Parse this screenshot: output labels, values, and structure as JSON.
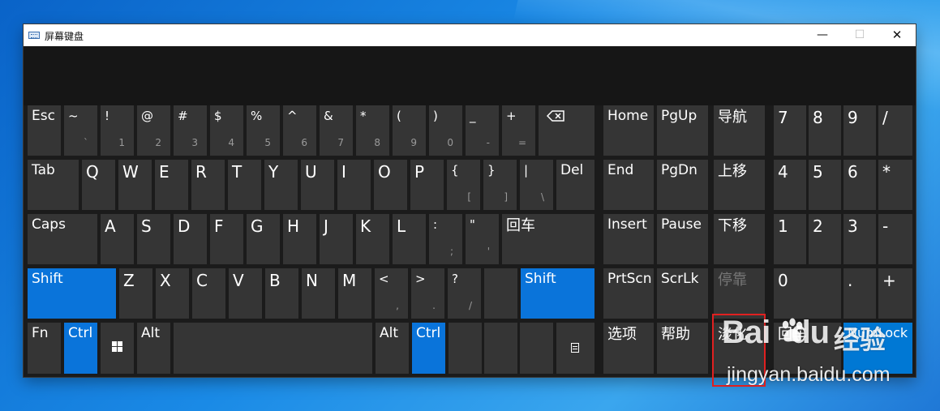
{
  "window": {
    "title": "屏幕键盘",
    "minimize": "—",
    "maximize": "☐",
    "close": "✕"
  },
  "keys": {
    "esc": "Esc",
    "tilde_top": "~",
    "tilde_bottom": "`",
    "k1_top": "!",
    "k1_bottom": "1",
    "k2_top": "@",
    "k2_bottom": "2",
    "k3_top": "#",
    "k3_bottom": "3",
    "k4_top": "$",
    "k4_bottom": "4",
    "k5_top": "%",
    "k5_bottom": "5",
    "k6_top": "^",
    "k6_bottom": "6",
    "k7_top": "&",
    "k7_bottom": "7",
    "k8_top": "*",
    "k8_bottom": "8",
    "k9_top": "(",
    "k9_bottom": "9",
    "k0_top": ")",
    "k0_bottom": "0",
    "minus_top": "_",
    "minus_bottom": "-",
    "equals_top": "+",
    "equals_bottom": "=",
    "tab": "Tab",
    "q": "Q",
    "w": "W",
    "e": "E",
    "r": "R",
    "t": "T",
    "y": "Y",
    "u": "U",
    "i": "I",
    "o": "O",
    "p": "P",
    "lbracket_top": "{",
    "lbracket_bottom": "[",
    "rbracket_top": "}",
    "rbracket_bottom": "]",
    "backslash_top": "|",
    "backslash_bottom": "\\",
    "del": "Del",
    "caps": "Caps",
    "a": "A",
    "s": "S",
    "d": "D",
    "f": "F",
    "g": "G",
    "h": "H",
    "j": "J",
    "k": "K",
    "l": "L",
    "semicolon_top": ":",
    "semicolon_bottom": ";",
    "quote_top": "\"",
    "quote_bottom": "'",
    "enter": "回车",
    "lshift": "Shift",
    "z": "Z",
    "x": "X",
    "c": "C",
    "v": "V",
    "b": "B",
    "n": "N",
    "m": "M",
    "comma_top": "<",
    "comma_bottom": ",",
    "period_top": ">",
    "period_bottom": ".",
    "slash_top": "?",
    "slash_bottom": "/",
    "rshift": "Shift",
    "fn": "Fn",
    "lctrl": "Ctrl",
    "lalt": "Alt",
    "ralt": "Alt",
    "rctrl": "Ctrl"
  },
  "nav_keys": {
    "home": "Home",
    "pgup": "PgUp",
    "navigate": "导航",
    "end": "End",
    "pgdn": "PgDn",
    "move_up": "上移",
    "insert": "Insert",
    "pause": "Pause",
    "move_down": "下移",
    "prtscn": "PrtScn",
    "scrlk": "ScrLk",
    "dock": "停靠",
    "options": "选项",
    "help": "帮助",
    "fade": "淡化"
  },
  "numpad": {
    "n7": "7",
    "n8": "8",
    "n9": "9",
    "divide": "/",
    "n4": "4",
    "n5": "5",
    "n6": "6",
    "multiply": "*",
    "n1": "1",
    "n2": "2",
    "n3": "3",
    "subtract": "-",
    "n0": "0",
    "decimal": ".",
    "add": "+",
    "enter": "回车",
    "numlock": "NumLock"
  },
  "watermark": {
    "brand": "Bai",
    "brand_du": "du",
    "jingyan": "经验",
    "url": "jingyan.baidu.com"
  },
  "colors": {
    "key_bg": "#353535",
    "key_active": "#0a74da",
    "window_bg": "#1b1b1b",
    "highlight": "#e02020"
  }
}
